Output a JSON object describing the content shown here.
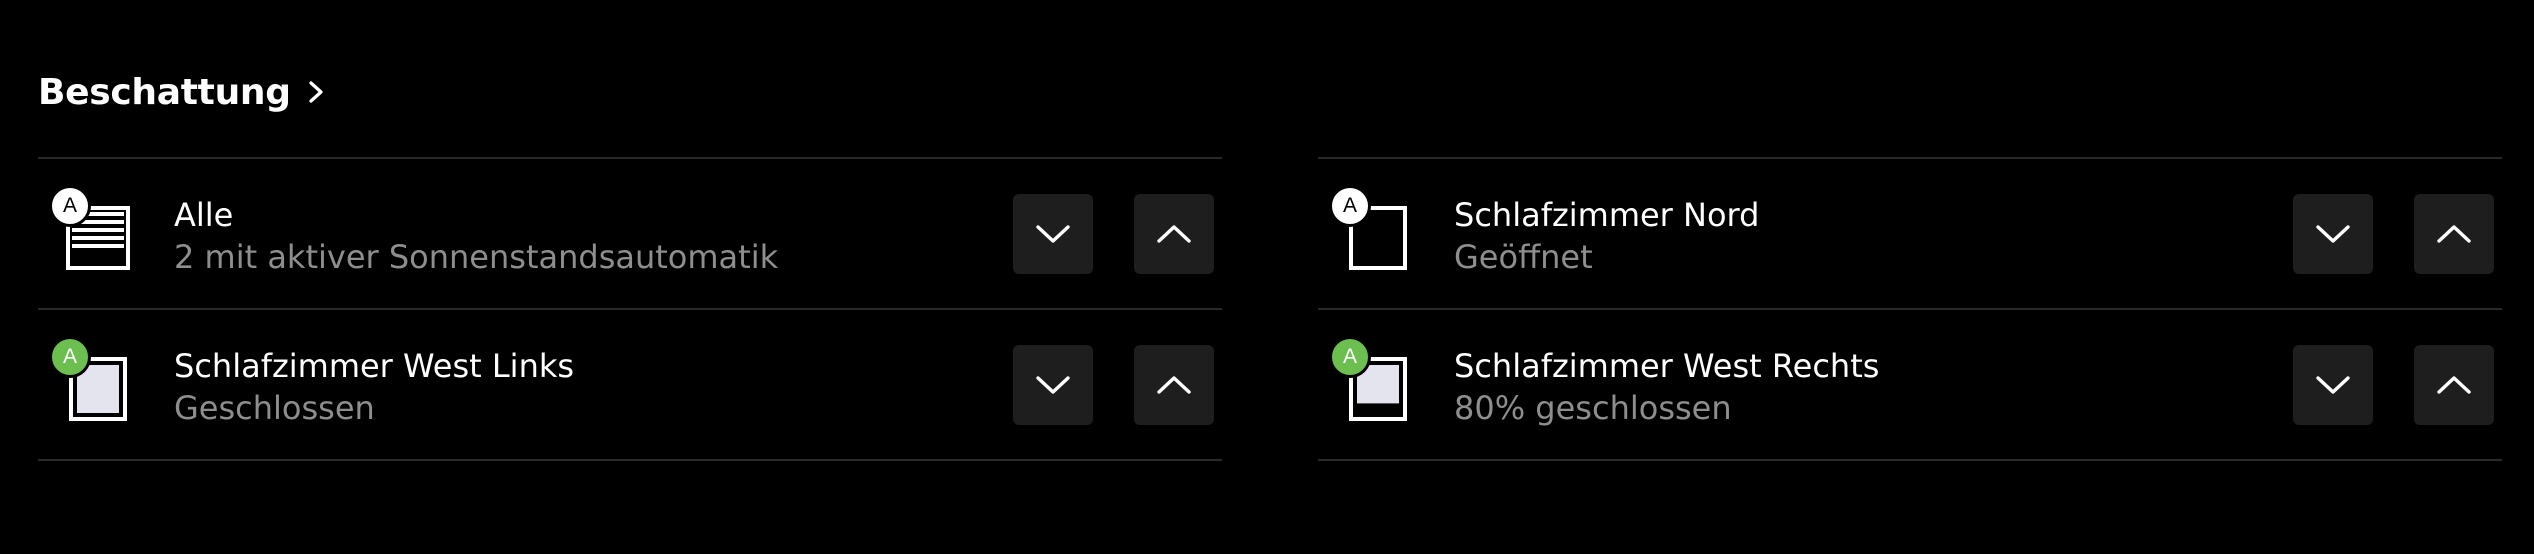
{
  "section": {
    "title": "Beschattung"
  },
  "colors": {
    "background": "#000000",
    "button_bg": "#1e1e1e",
    "divider": "#2a2a2a",
    "subtitle": "#8e8e8e",
    "badge_auto_active": "#6cbf4e",
    "badge_auto_inactive": "#ffffff"
  },
  "devices": [
    {
      "title": "Alle",
      "subtitle": "2 mit aktiver Sonnenstandsautomatik",
      "badge": "A",
      "badge_color": "white",
      "icon": "blinds-group-icon"
    },
    {
      "title": "Schlafzimmer Nord",
      "subtitle": "Geöffnet",
      "badge": "A",
      "badge_color": "white",
      "icon": "window-open-icon"
    },
    {
      "title": "Schlafzimmer West Links",
      "subtitle": "Geschlossen",
      "badge": "A",
      "badge_color": "green",
      "icon": "window-closed-icon"
    },
    {
      "title": "Schlafzimmer West Rechts",
      "subtitle": "80% geschlossen",
      "badge": "A",
      "badge_color": "green",
      "icon": "window-partial-icon",
      "position_closed_fraction": 0.8
    }
  ],
  "controls": {
    "down_icon": "chevron-down-icon",
    "up_icon": "chevron-up-icon"
  }
}
